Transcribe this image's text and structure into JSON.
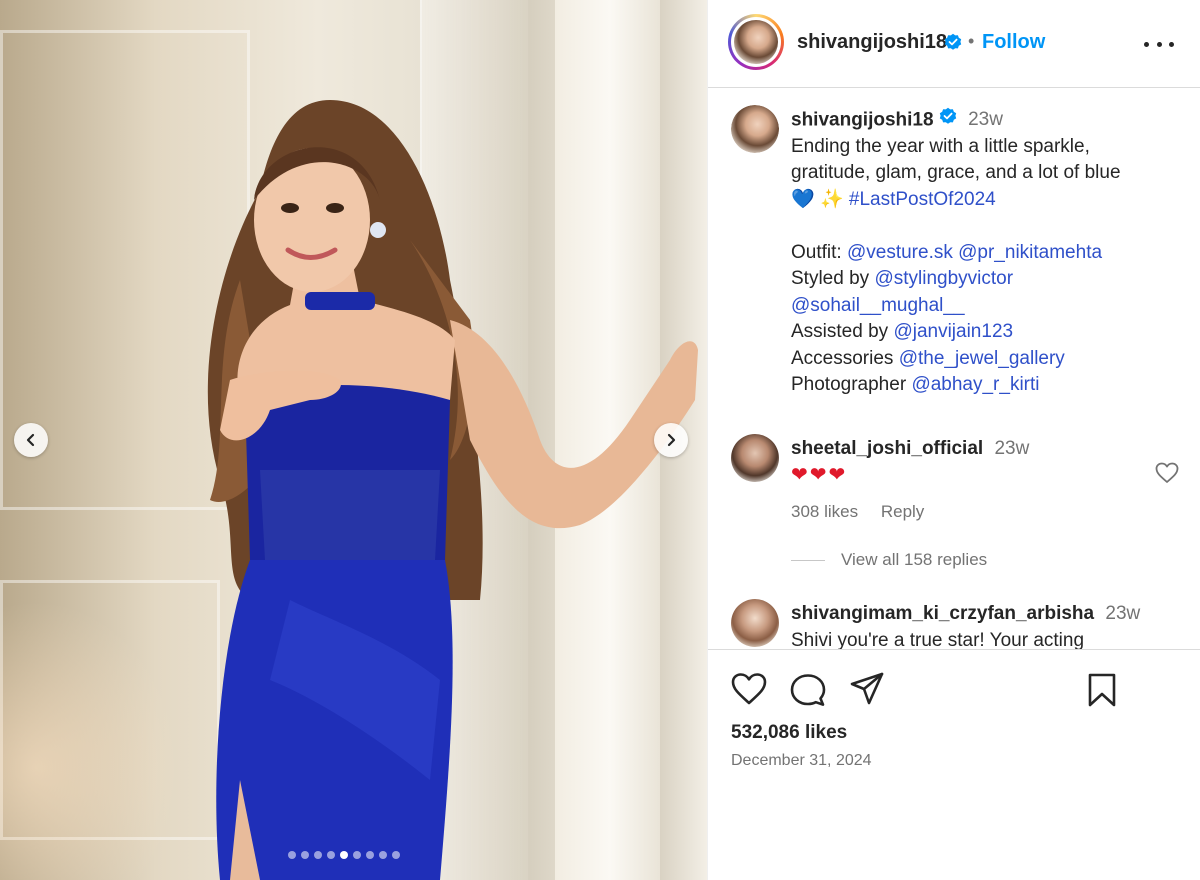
{
  "post": {
    "username": "shivangijoshi18",
    "separator": "•",
    "follow_label": "Follow",
    "more_icon": "more-horizontal-icon",
    "caption": {
      "time": "23w",
      "line1": "Ending the year with a little sparkle,",
      "line2": "gratitude, glam, grace, and a lot of blue",
      "emoji_heart": "💙",
      "emoji_sparkle": "✨",
      "hashtag": "#LastPostOf2024",
      "outfit_label": "Outfit:",
      "outfit_tag1": "@vesture.sk",
      "outfit_tag2": "@pr_nikitamehta",
      "styled_label": "Styled by",
      "styled_tag1": "@stylingbyvictor",
      "styled_tag2": "@sohail__mughal__",
      "assisted_label": "Assisted by",
      "assisted_tag": "@janvijain123",
      "accessories_label": "Accessories",
      "accessories_tag": "@the_jewel_gallery",
      "photographer_label": "Photographer",
      "photographer_tag": "@abhay_r_kirti"
    },
    "comments": [
      {
        "username": "sheetal_joshi_official",
        "time": "23w",
        "text": "❤❤❤",
        "likes": "308 likes",
        "reply_label": "Reply",
        "view_replies": "View all 158 replies"
      },
      {
        "username": "shivangimam_ki_crzyfan_arbisha",
        "time": "23w",
        "text": "Shivi you're a true star! Your acting"
      }
    ],
    "likes_count": "532,086 likes",
    "date": "December 31, 2024"
  },
  "carousel": {
    "total_slides": 9,
    "active_slide": 5,
    "prev_icon": "chevron-left-icon",
    "next_icon": "chevron-right-icon"
  },
  "colors": {
    "follow": "#0095f6",
    "verified": "#0095f6",
    "mention": "#2f50c9",
    "muted": "#737373",
    "dress_blue": "#1f2fb8"
  }
}
